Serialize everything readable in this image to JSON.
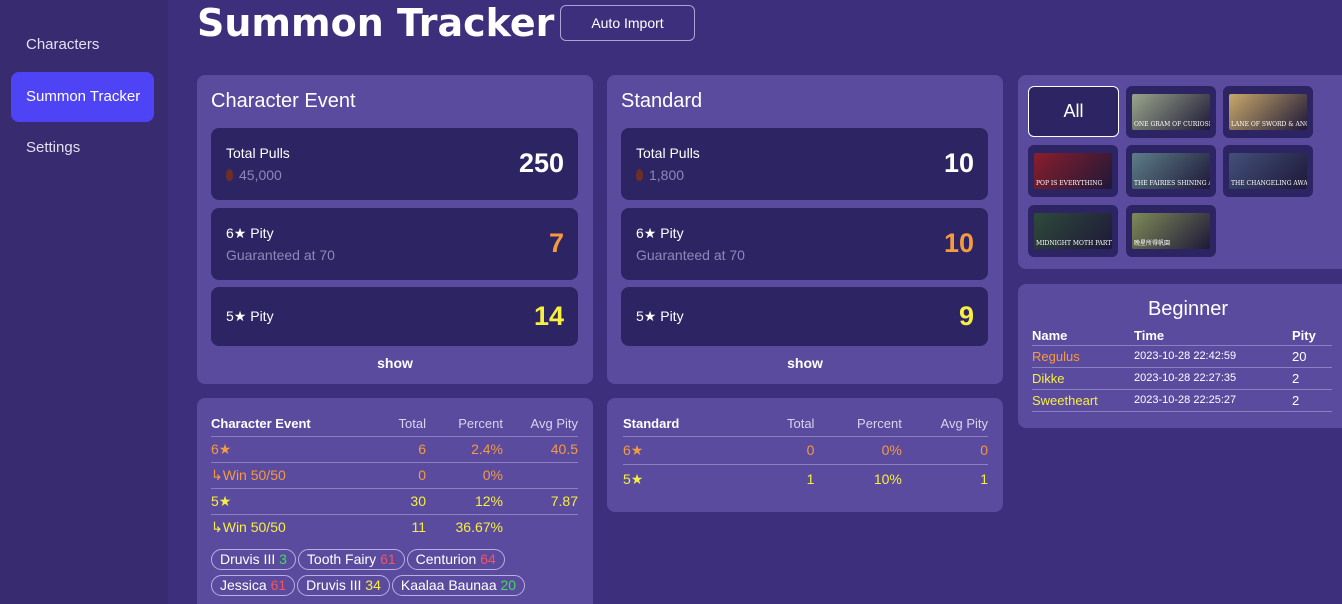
{
  "sidebar": {
    "items": [
      {
        "label": "Characters"
      },
      {
        "label": "Summon Tracker"
      },
      {
        "label": "Settings"
      }
    ]
  },
  "header": {
    "title": "Summon Tracker",
    "import_label": "Auto Import"
  },
  "character_event": {
    "title": "Character Event",
    "total_pulls_label": "Total Pulls",
    "total_pulls_value": "250",
    "total_pulls_cost": "45,000",
    "six_pity_label": "6★ Pity",
    "six_pity_sub": "Guaranteed at 70",
    "six_pity_value": "7",
    "five_pity_label": "5★ Pity",
    "five_pity_value": "14",
    "show_label": "show"
  },
  "standard": {
    "title": "Standard",
    "total_pulls_label": "Total Pulls",
    "total_pulls_value": "10",
    "total_pulls_cost": "1,800",
    "six_pity_label": "6★ Pity",
    "six_pity_sub": "Guaranteed at 70",
    "six_pity_value": "10",
    "five_pity_label": "5★ Pity",
    "five_pity_value": "9",
    "show_label": "show"
  },
  "character_stats": {
    "headers": [
      "Character Event",
      "Total",
      "Percent",
      "Avg Pity"
    ],
    "rows": [
      {
        "label": "6★",
        "total": "6",
        "percent": "2.4%",
        "avg": "40.5"
      },
      {
        "label": "↳Win 50/50",
        "total": "0",
        "percent": "0%",
        "avg": ""
      },
      {
        "label": "5★",
        "total": "30",
        "percent": "12%",
        "avg": "7.87"
      },
      {
        "label": "↳Win 50/50",
        "total": "11",
        "percent": "36.67%",
        "avg": ""
      }
    ],
    "chips": [
      {
        "name": "Druvis III",
        "pity": "3"
      },
      {
        "name": "Tooth Fairy",
        "pity": "61"
      },
      {
        "name": "Centurion",
        "pity": "64"
      },
      {
        "name": "Jessica",
        "pity": "61"
      },
      {
        "name": "Druvis III",
        "pity": "34"
      },
      {
        "name": "Kaalaa Baunaa",
        "pity": "20"
      }
    ]
  },
  "standard_stats": {
    "headers": [
      "Standard",
      "Total",
      "Percent",
      "Avg Pity"
    ],
    "rows": [
      {
        "label": "6★",
        "total": "0",
        "percent": "0%",
        "avg": "0"
      },
      {
        "label": "5★",
        "total": "1",
        "percent": "10%",
        "avg": "1"
      }
    ]
  },
  "banners": {
    "all_label": "All",
    "items": [
      {
        "caption": "ONE GRAM OF CURIOSITY",
        "color": "#9aa58a"
      },
      {
        "caption": "LANE OF SWORD & ANCHOR",
        "color": "#c8a86a"
      },
      {
        "caption": "POP IS EVERYTHING",
        "color": "#8a1e2c"
      },
      {
        "caption": "THE FAIRIES SHINING AT NIGHT",
        "color": "#5d7e88"
      },
      {
        "caption": "THE CHANGELING AWAITS",
        "color": "#43507a"
      },
      {
        "caption": "MIDNIGHT MOTH PARTY",
        "color": "#2e4a3a"
      },
      {
        "caption": "晚星所得帆園",
        "color": "#7e8a58"
      }
    ]
  },
  "beginner": {
    "title": "Beginner",
    "headers": [
      "Name",
      "Time",
      "Pity"
    ],
    "rows": [
      {
        "name": "Regulus",
        "time": "2023-10-28 22:42:59",
        "pity": "20",
        "color": "#f59a3e"
      },
      {
        "name": "Dikke",
        "time": "2023-10-28 22:27:35",
        "pity": "2",
        "color": "#f6ef3f"
      },
      {
        "name": "Sweetheart",
        "time": "2023-10-28 22:25:27",
        "pity": "2",
        "color": "#f6ef3f"
      }
    ]
  }
}
